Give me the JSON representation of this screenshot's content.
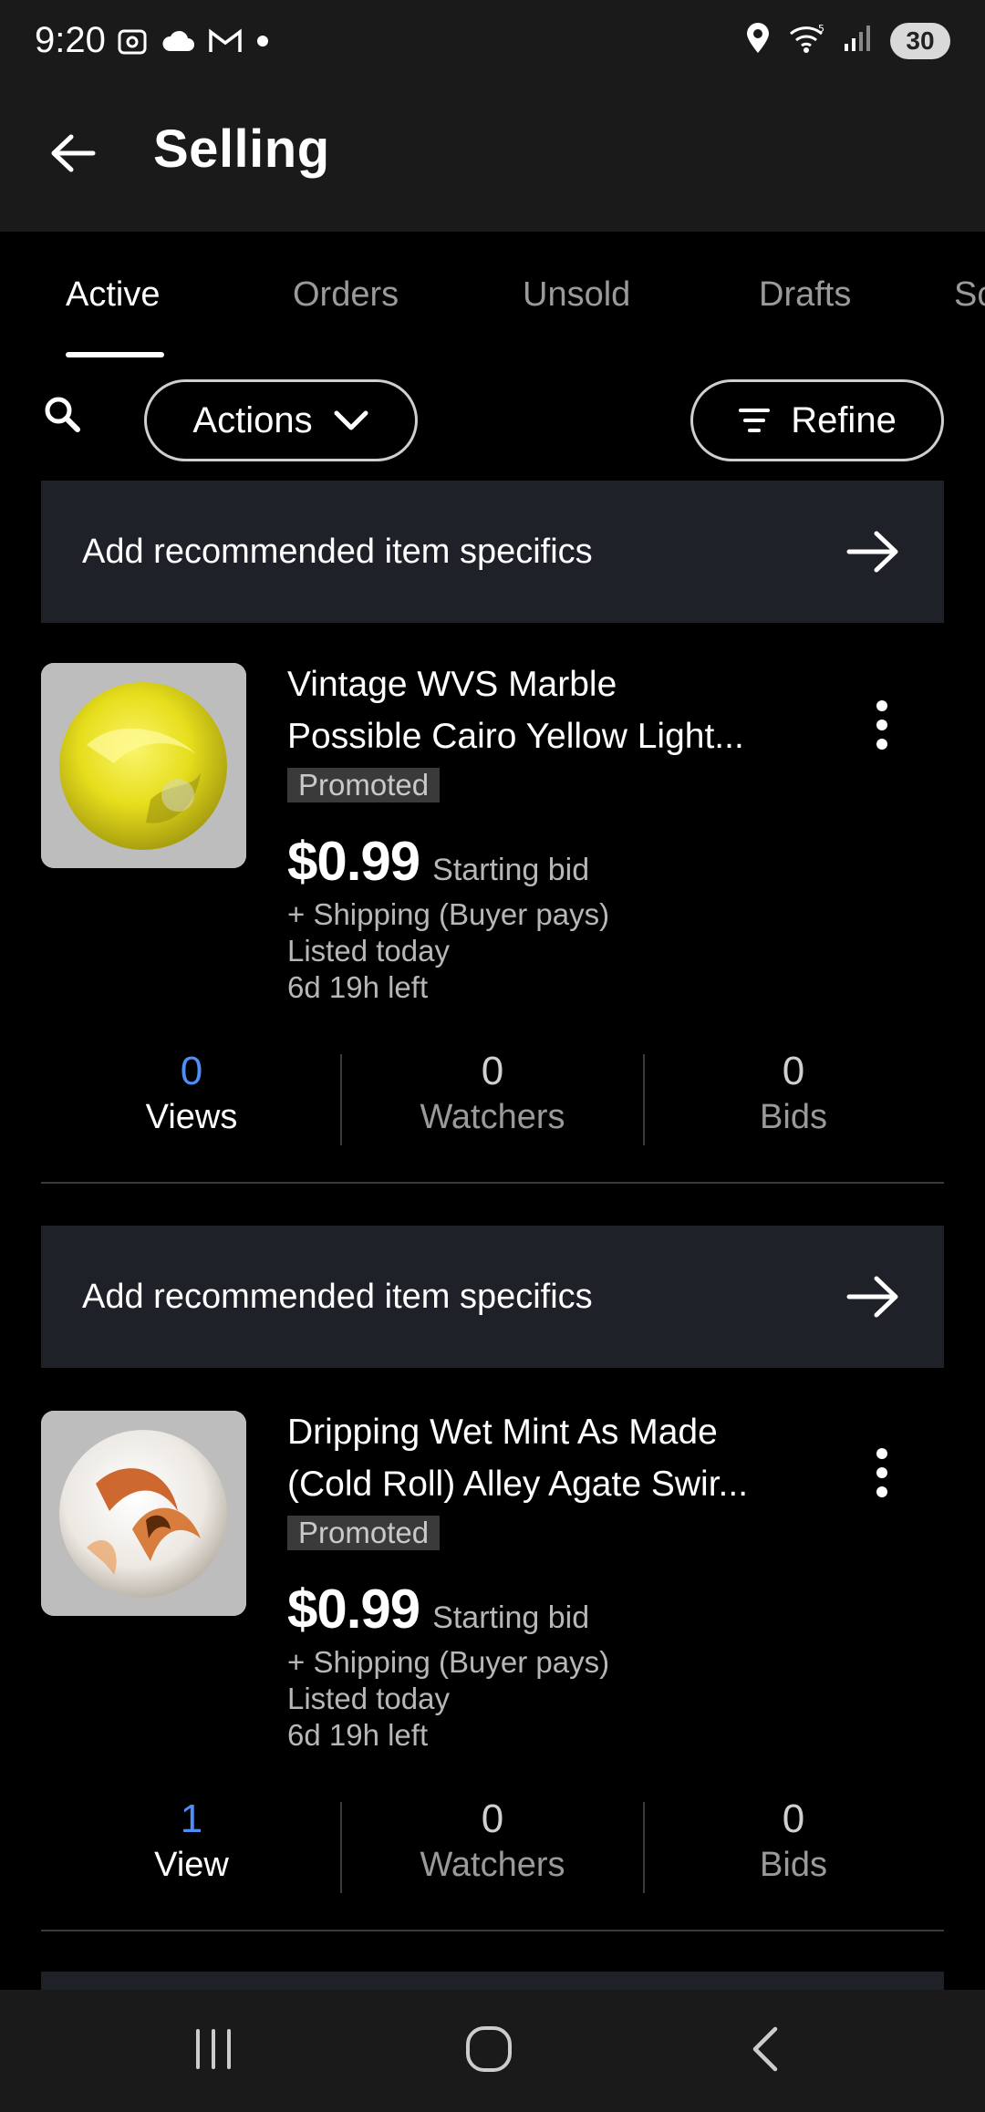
{
  "status_bar": {
    "time": "9:20",
    "battery": "30",
    "left_icons": [
      "screenshot-icon",
      "cloud-icon",
      "gmail-icon",
      "dot-icon"
    ],
    "right_icons": [
      "location-icon",
      "wifi-icon",
      "signal-icon",
      "battery-icon"
    ]
  },
  "app_bar": {
    "title": "Selling"
  },
  "tabs": [
    {
      "label": "Active",
      "active": true
    },
    {
      "label": "Orders",
      "active": false
    },
    {
      "label": "Unsold",
      "active": false
    },
    {
      "label": "Drafts",
      "active": false
    },
    {
      "label": "Sc",
      "active": false
    }
  ],
  "filters": {
    "actions_label": "Actions",
    "refine_label": "Refine"
  },
  "listings": [
    {
      "banner": "Add recommended item specifics",
      "title_line1": "Vintage WVS Marble",
      "title_line2": "Possible Cairo Yellow Light...",
      "badge": "Promoted",
      "price": "$0.99",
      "price_note": "Starting bid",
      "shipping": "+ Shipping (Buyer pays)",
      "listed": "Listed today",
      "time_left": "6d 19h left",
      "stats": {
        "views": "0",
        "views_label": "Views",
        "watchers": "0",
        "watchers_label": "Watchers",
        "bids": "0",
        "bids_label": "Bids"
      }
    },
    {
      "banner": "Add recommended item specifics",
      "title_line1": "Dripping Wet Mint As Made",
      "title_line2": "(Cold Roll) Alley Agate Swir...",
      "badge": "Promoted",
      "price": "$0.99",
      "price_note": "Starting bid",
      "shipping": "+ Shipping (Buyer pays)",
      "listed": "Listed today",
      "time_left": "6d 19h left",
      "stats": {
        "views": "1",
        "views_label": "View",
        "watchers": "0",
        "watchers_label": "Watchers",
        "bids": "0",
        "bids_label": "Bids"
      }
    }
  ],
  "colors": {
    "background": "#000000",
    "bar": "#1a1a1a",
    "banner": "#1e2228",
    "views_blue": "#4f8ef7",
    "marble_yellow": "#e8e020",
    "marble_orange": "#c8581a"
  }
}
